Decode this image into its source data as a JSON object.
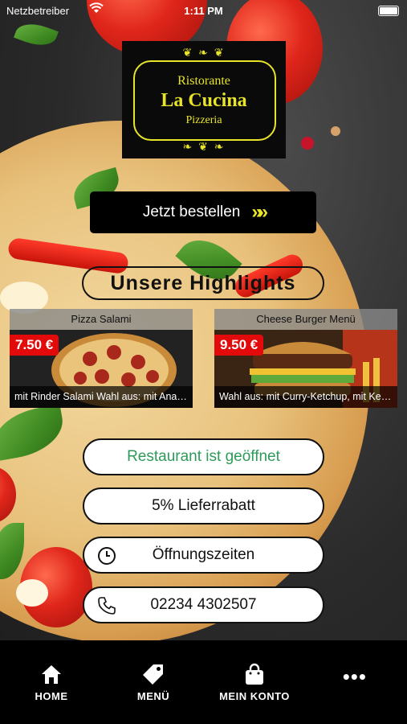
{
  "status_bar": {
    "carrier": "Netzbetreiber",
    "time": "1:11 PM"
  },
  "logo": {
    "line1": "Ristorante",
    "line2": "La Cucina",
    "line3": "Pizzeria"
  },
  "order_button": {
    "label": "Jetzt bestellen"
  },
  "highlights": {
    "title": "Unsere Highlights"
  },
  "products": [
    {
      "name": "Pizza Salami",
      "price": "7.50 €",
      "description": "mit Rinder Salami Wahl aus: mit Ananas..."
    },
    {
      "name": "Cheese Burger Menü",
      "price": "9.50 €",
      "description": "Wahl aus: mit Curry-Ketchup, mit Ketch..."
    }
  ],
  "info": {
    "open_status": "Restaurant ist geöffnet",
    "discount": "5% Lieferrabatt",
    "hours": "Öffnungszeiten",
    "phone": "02234 4302507"
  },
  "nav": {
    "home": "HOME",
    "menu": "MENÜ",
    "account": "MEIN KONTO"
  },
  "colors": {
    "accent_yellow": "#e8e42a",
    "price_red": "#e20a0a",
    "open_green": "#2e9a5a"
  }
}
